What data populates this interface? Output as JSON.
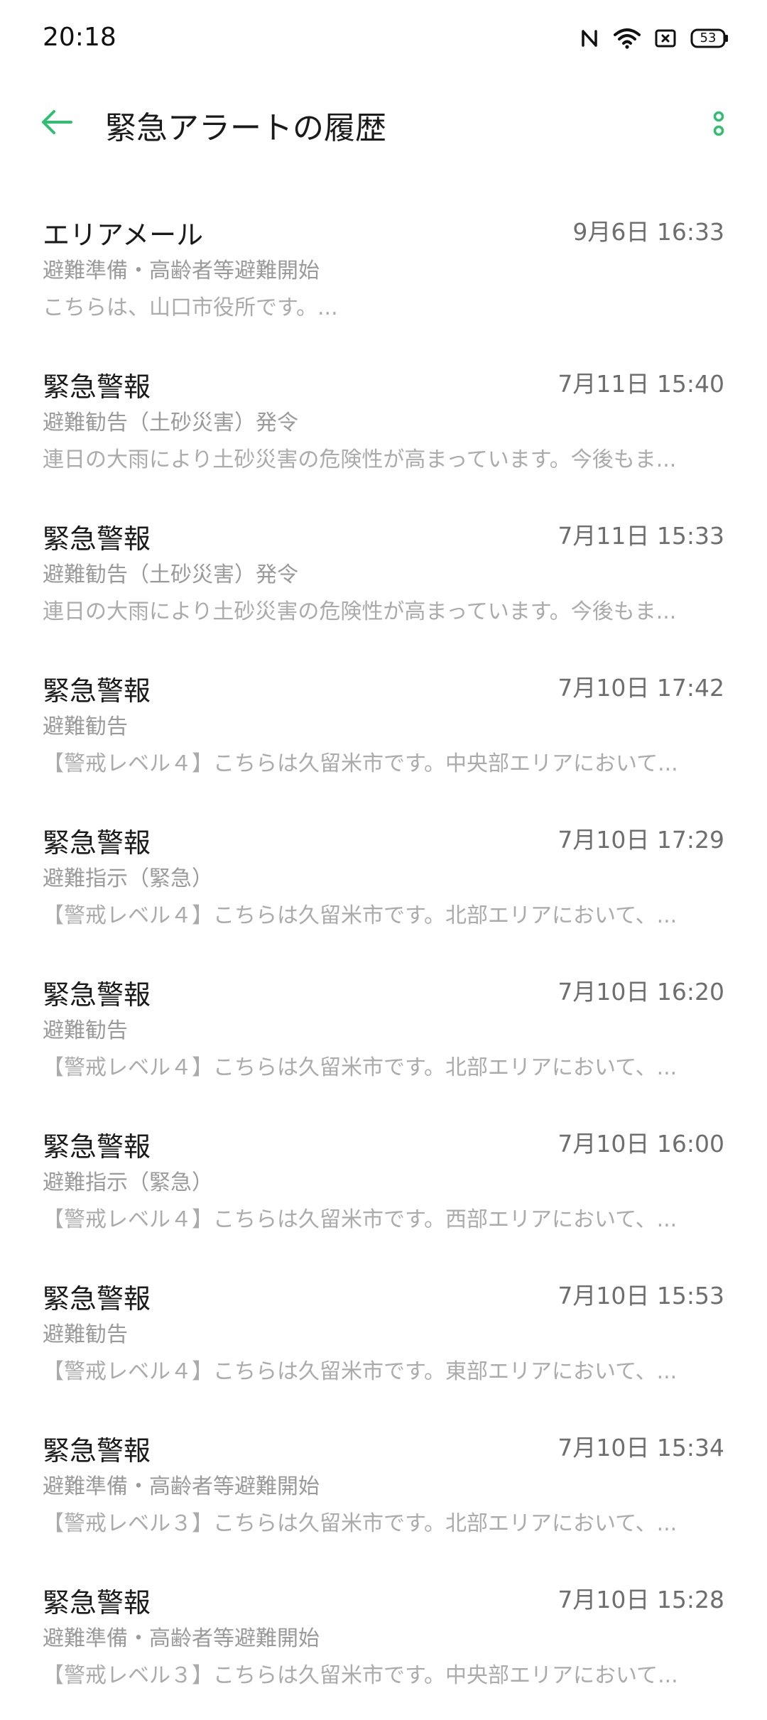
{
  "status_bar": {
    "time": "20:18",
    "battery": "53",
    "icons": [
      "nfc-icon",
      "wifi-icon",
      "sim-icon",
      "battery-icon"
    ]
  },
  "app_bar": {
    "title": "緊急アラートの履歴",
    "back_icon": "arrow-left-icon",
    "menu_icon": "more-vertical-icon",
    "accent_color": "#2fbf71"
  },
  "alerts": [
    {
      "title": "エリアメール",
      "time": "9月6日 16:33",
      "subtitle": "避難準備・高齢者等避難開始",
      "body": "こちらは、山口市役所です。..."
    },
    {
      "title": "緊急警報",
      "time": "7月11日 15:40",
      "subtitle": "避難勧告（土砂災害）発令",
      "body": "連日の大雨により土砂災害の危険性が高まっています。今後もま..."
    },
    {
      "title": "緊急警報",
      "time": "7月11日 15:33",
      "subtitle": "避難勧告（土砂災害）発令",
      "body": "連日の大雨により土砂災害の危険性が高まっています。今後もま..."
    },
    {
      "title": "緊急警報",
      "time": "7月10日 17:42",
      "subtitle": "避難勧告",
      "body": "【警戒レベル４】こちらは久留米市です。中央部エリアにおいて..."
    },
    {
      "title": "緊急警報",
      "time": "7月10日 17:29",
      "subtitle": "避難指示（緊急）",
      "body": "【警戒レベル４】こちらは久留米市です。北部エリアにおいて、..."
    },
    {
      "title": "緊急警報",
      "time": "7月10日 16:20",
      "subtitle": "避難勧告",
      "body": "【警戒レベル４】こちらは久留米市です。北部エリアにおいて、..."
    },
    {
      "title": "緊急警報",
      "time": "7月10日 16:00",
      "subtitle": "避難指示（緊急）",
      "body": "【警戒レベル４】こちらは久留米市です。西部エリアにおいて、..."
    },
    {
      "title": "緊急警報",
      "time": "7月10日 15:53",
      "subtitle": "避難勧告",
      "body": "【警戒レベル４】こちらは久留米市です。東部エリアにおいて、..."
    },
    {
      "title": "緊急警報",
      "time": "7月10日 15:34",
      "subtitle": "避難準備・高齢者等避難開始",
      "body": "【警戒レベル３】こちらは久留米市です。北部エリアにおいて、..."
    },
    {
      "title": "緊急警報",
      "time": "7月10日 15:28",
      "subtitle": "避難準備・高齢者等避難開始",
      "body": "【警戒レベル３】こちらは久留米市です。中央部エリアにおいて..."
    }
  ]
}
